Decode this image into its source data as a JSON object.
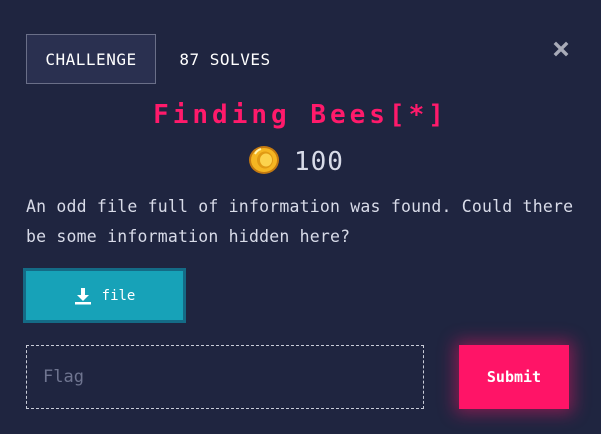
{
  "tabs": {
    "challenge_label": "CHALLENGE",
    "solves_label": "87 SOLVES"
  },
  "close_icon": "close-icon",
  "challenge": {
    "title": "Finding Bees[*]",
    "points": "100",
    "points_icon": "coin-icon",
    "description": "An odd file full of information was found. Could there be some information hidden here?"
  },
  "file": {
    "label": "file",
    "icon": "download-icon"
  },
  "flag": {
    "placeholder": "Flag",
    "value": ""
  },
  "submit_label": "Submit",
  "colors": {
    "background": "#1f2540",
    "accent": "#ff1467",
    "file_button": "#17a2b8",
    "coin": "#f5b622"
  }
}
